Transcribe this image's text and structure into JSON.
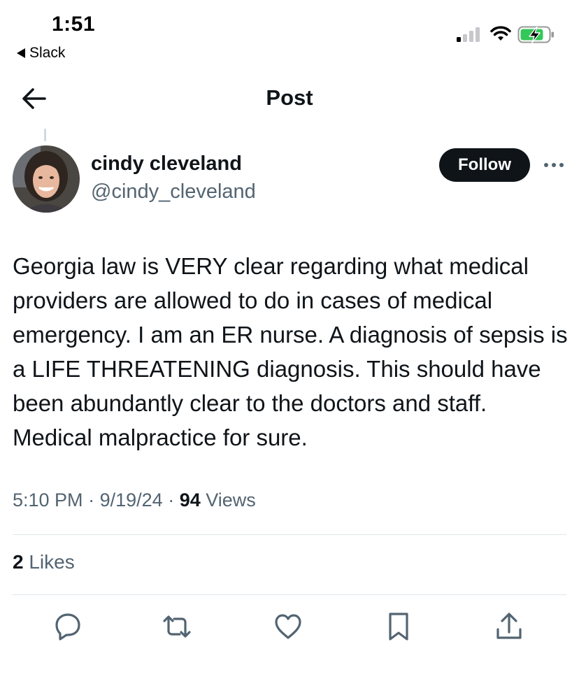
{
  "status_bar": {
    "time": "1:51",
    "back_app_label": "Slack"
  },
  "nav": {
    "title": "Post"
  },
  "author": {
    "display_name": "cindy cleveland",
    "handle": "@cindy_cleveland"
  },
  "follow_label": "Follow",
  "post": {
    "text": "Georgia law is VERY clear regarding what medical providers are allowed to do in cases of medical emergency. I am an ER nurse. A diagnosis of sepsis is a LIFE THREATENING diagnosis. This should have been abundantly clear to the doctors and staff. Medical malpractice for sure.",
    "time": "5:10 PM",
    "date": "9/19/24",
    "views_count": "94",
    "views_label": "Views",
    "likes_count": "2",
    "likes_label": "Likes"
  },
  "actions": [
    "reply-icon",
    "repost-icon",
    "like-icon",
    "bookmark-icon",
    "share-icon"
  ],
  "colors": {
    "text_primary": "#0f1419",
    "text_secondary": "#536471",
    "follow_bg": "#0f1419",
    "battery_charge": "#34c759",
    "divider": "#e1e6ea"
  }
}
